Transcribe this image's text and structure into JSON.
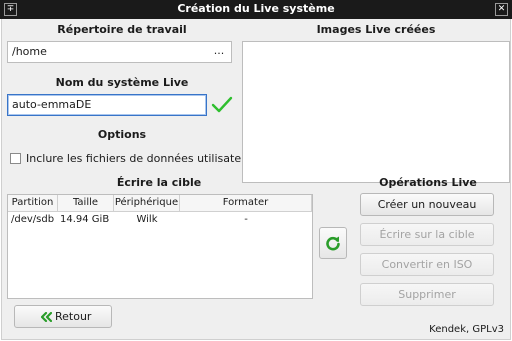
{
  "window": {
    "title": "Création du Live système",
    "menu_glyph": "∓",
    "close_glyph": "✕"
  },
  "work_dir": {
    "heading": "Répertoire de travail",
    "value": "/home",
    "browse_label": "..."
  },
  "live_name": {
    "heading": "Nom du système Live",
    "value": "auto-emmaDE",
    "valid_icon": "checkmark-icon",
    "valid_color": "#2fbf2f"
  },
  "options": {
    "heading": "Options",
    "include_user_data_label": "Inclure les fichiers de données utilisateur",
    "include_user_data_checked": false
  },
  "images": {
    "heading": "Images Live créées",
    "items": []
  },
  "target": {
    "heading": "Écrire la cible",
    "columns": [
      "Partition",
      "Taille",
      "Périphérique",
      "Formater"
    ],
    "rows": [
      {
        "partition": "/dev/sdb",
        "size": "14.94 GiB",
        "device": "Wilk",
        "format": "-"
      }
    ]
  },
  "operations": {
    "heading": "Opérations Live",
    "create_label": "Créer un nouveau",
    "write_label": "Écrire sur la cible",
    "convert_label": "Convertir en ISO",
    "delete_label": "Supprimer",
    "refresh_icon": "refresh-icon",
    "accent_color": "#2a9d2a"
  },
  "back_button": {
    "label": "Retour",
    "icon": "double-chevron-left-icon"
  },
  "credit": "Kendek, GPLv3"
}
